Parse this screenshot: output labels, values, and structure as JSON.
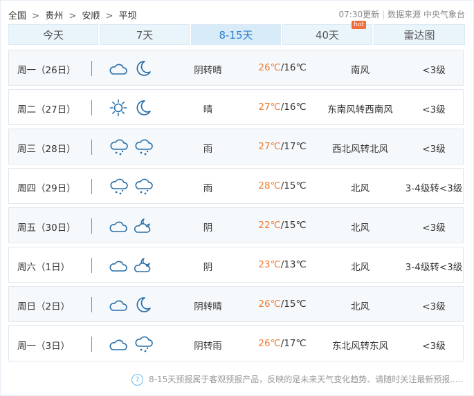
{
  "breadcrumb": [
    "全国",
    "贵州",
    "安顺",
    "平坝"
  ],
  "breadcrumb_sep": ">",
  "update_time": "07:30更新",
  "source": "数据来源 中央气象台",
  "tabs": [
    {
      "label": "今天"
    },
    {
      "label": "7天"
    },
    {
      "label": "8-15天",
      "active": true
    },
    {
      "label": "40天",
      "badge": "hot"
    },
    {
      "label": "雷达图"
    }
  ],
  "days": [
    {
      "date": "周一（26日）",
      "icon_day": "cloudy-icon",
      "icon_night": "moon-icon",
      "weather": "阴转晴",
      "high": "26℃",
      "low": "/16℃",
      "wind": "南风",
      "level": "<3级"
    },
    {
      "date": "周二（27日）",
      "icon_day": "sun-icon",
      "icon_night": "moon-icon",
      "weather": "晴",
      "high": "27℃",
      "low": "/16℃",
      "wind": "东南风转西南风",
      "level": "<3级"
    },
    {
      "date": "周三（28日）",
      "icon_day": "rain-icon",
      "icon_night": "rain-icon",
      "weather": "雨",
      "high": "27℃",
      "low": "/17℃",
      "wind": "西北风转北风",
      "level": "<3级"
    },
    {
      "date": "周四（29日）",
      "icon_day": "rain-icon",
      "icon_night": "rain-icon",
      "weather": "雨",
      "high": "28℃",
      "low": "/15℃",
      "wind": "北风",
      "level": "3-4级转<3级"
    },
    {
      "date": "周五（30日）",
      "icon_day": "cloudy-icon",
      "icon_night": "cloudy-night-icon",
      "weather": "阴",
      "high": "22℃",
      "low": "/15℃",
      "wind": "北风",
      "level": "<3级"
    },
    {
      "date": "周六（1日）",
      "icon_day": "cloudy-icon",
      "icon_night": "cloudy-night-icon",
      "weather": "阴",
      "high": "23℃",
      "low": "/13℃",
      "wind": "北风",
      "level": "3-4级转<3级"
    },
    {
      "date": "周日（2日）",
      "icon_day": "cloudy-icon",
      "icon_night": "moon-icon",
      "weather": "阴转晴",
      "high": "26℃",
      "low": "/15℃",
      "wind": "北风",
      "level": "<3级"
    },
    {
      "date": "周一（3日）",
      "icon_day": "cloudy-icon",
      "icon_night": "rain-icon",
      "weather": "阴转雨",
      "high": "26℃",
      "low": "/17℃",
      "wind": "东北风转东风",
      "level": "<3级"
    }
  ],
  "footer_note": "8-15天预报属于客观预报产品，反映的是未来天气变化趋势、请随时关注最新预报.....",
  "footer_icon": "?",
  "colors": {
    "accent": "#2d7dc8",
    "high_temp": "#f07c32",
    "icon_stroke": "#2a6fa8"
  }
}
